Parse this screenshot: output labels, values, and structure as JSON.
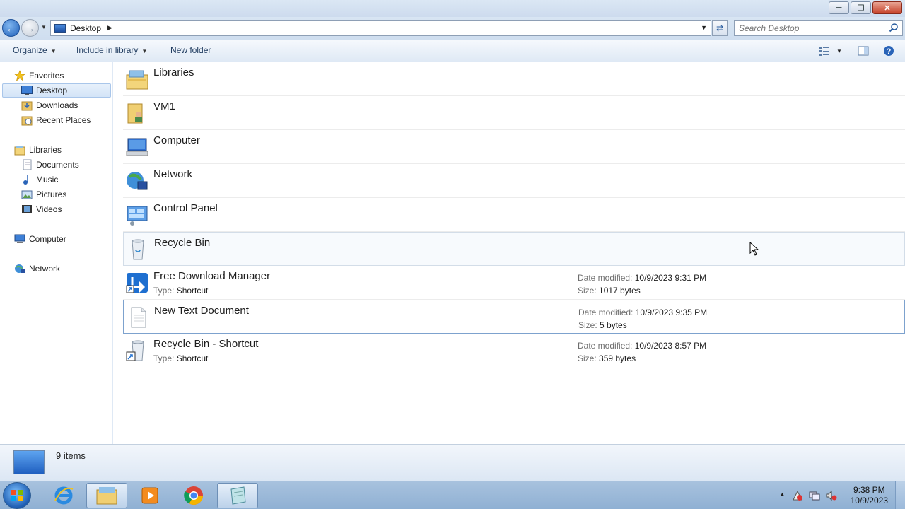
{
  "window": {
    "controls": {
      "minimize": "─",
      "maximize": "❐",
      "close": "✕"
    }
  },
  "address": {
    "crumbs": [
      "Desktop"
    ],
    "search_placeholder": "Search Desktop"
  },
  "toolbar": {
    "organize": "Organize",
    "include_in_library": "Include in library",
    "new_folder": "New folder"
  },
  "nav": {
    "favorites": {
      "label": "Favorites",
      "items": [
        {
          "label": "Desktop",
          "selected": true
        },
        {
          "label": "Downloads"
        },
        {
          "label": "Recent Places"
        }
      ]
    },
    "libraries": {
      "label": "Libraries",
      "items": [
        {
          "label": "Documents"
        },
        {
          "label": "Music"
        },
        {
          "label": "Pictures"
        },
        {
          "label": "Videos"
        }
      ]
    },
    "computer": "Computer",
    "network": "Network"
  },
  "files": [
    {
      "name": "Libraries",
      "icon": "libraries-icon"
    },
    {
      "name": "VM1",
      "icon": "user-folder-icon"
    },
    {
      "name": "Computer",
      "icon": "computer-icon"
    },
    {
      "name": "Network",
      "icon": "network-icon"
    },
    {
      "name": "Control Panel",
      "icon": "control-panel-icon"
    },
    {
      "name": "Recycle Bin",
      "icon": "recycle-bin-icon",
      "state": "hover"
    },
    {
      "name": "Free Download Manager",
      "icon": "fdm-shortcut-icon",
      "type_label": "Type:",
      "type": "Shortcut",
      "date_label": "Date modified:",
      "date": "10/9/2023 9:31 PM",
      "size_label": "Size:",
      "size": "1017 bytes"
    },
    {
      "name": "New Text Document",
      "icon": "text-document-icon",
      "state": "focus",
      "date_label": "Date modified:",
      "date": "10/9/2023 9:35 PM",
      "size_label": "Size:",
      "size": "5 bytes"
    },
    {
      "name": "Recycle Bin - Shortcut",
      "icon": "recycle-bin-shortcut-icon",
      "type_label": "Type:",
      "type": "Shortcut",
      "date_label": "Date modified:",
      "date": "10/9/2023 8:57 PM",
      "size_label": "Size:",
      "size": "359 bytes"
    }
  ],
  "status": {
    "count": "9 items"
  },
  "taskbar": {
    "apps": [
      "start-orb-icon",
      "internet-explorer-icon",
      "windows-explorer-icon",
      "media-player-icon",
      "chrome-icon",
      "notepad-icon"
    ],
    "time": "9:38 PM",
    "date": "10/9/2023"
  },
  "colors": {
    "selection": "#d3e4f7",
    "accent": "#1f5fb8",
    "taskbar": "#9bb9da"
  }
}
